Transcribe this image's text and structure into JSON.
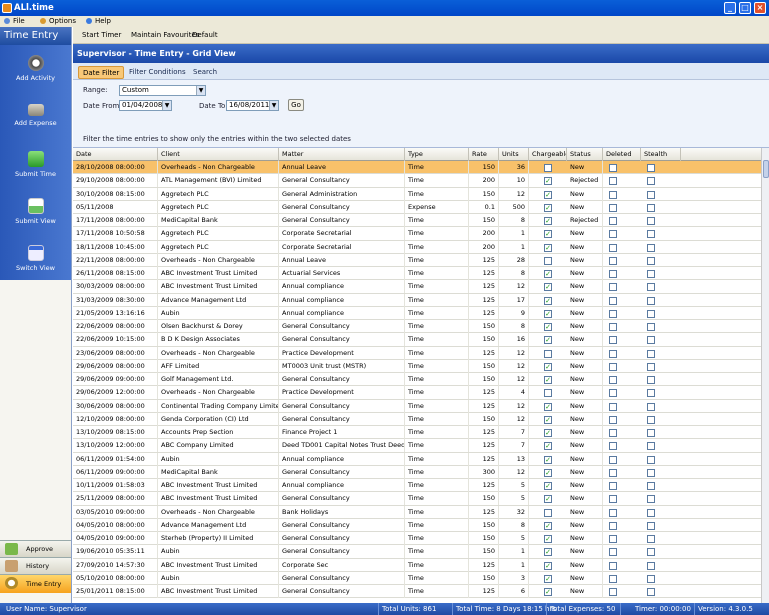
{
  "window": {
    "title": "ALl.time"
  },
  "menu": {
    "file": "File",
    "options": "Options",
    "help": "Help"
  },
  "sidebar": {
    "header": "Time Entry",
    "nav_items": [
      {
        "label": "Add Activity",
        "icon": "clock-icon"
      },
      {
        "label": "Add Expense",
        "icon": "scanner-icon"
      },
      {
        "label": "Submit Time",
        "icon": "upload-arrow-icon"
      },
      {
        "label": "Submit View",
        "icon": "submit-view-icon"
      },
      {
        "label": "Switch View",
        "icon": "window-icon"
      }
    ],
    "bottom_buttons": [
      {
        "label": "Approve",
        "icon": "approve-icon"
      },
      {
        "label": "History",
        "icon": "history-icon"
      },
      {
        "label": "Time Entry",
        "icon": "alarm-clock-icon"
      }
    ]
  },
  "toolbar": {
    "start_timer": "Start Timer",
    "maintain_favourites": "Maintain Favourites",
    "default": "Default"
  },
  "view_header": "Supervisor - Time Entry - Grid View",
  "filter_tabs": [
    "Date Filter",
    "Filter Conditions",
    "Search"
  ],
  "filter": {
    "range_label": "Range:",
    "range_value": "Custom",
    "date_from_label": "Date From:",
    "date_from_value": "01/04/2008",
    "date_to_label": "Date To:",
    "date_to_value": "16/08/2011",
    "go_label": "Go",
    "hint": "Filter the time entries to show only the entries within the two selected dates"
  },
  "grid": {
    "columns": [
      "Date",
      "Client",
      "Matter",
      "Type",
      "Rate",
      "Units",
      "Chargeable",
      "Status",
      "Deleted",
      "Stealth"
    ],
    "rows": [
      [
        "28/10/2008 08:00:00",
        "Overheads - Non Chargeable",
        "Annual Leave",
        "Time",
        "150",
        "36",
        false,
        "New"
      ],
      [
        "29/10/2008 08:00:00",
        "ATL Management (BVI) Limited",
        "General Consultancy",
        "Time",
        "200",
        "10",
        true,
        "Rejected"
      ],
      [
        "30/10/2008 08:15:00",
        "Aggretech PLC",
        "General Administration",
        "Time",
        "150",
        "12",
        true,
        "New"
      ],
      [
        "05/11/2008",
        "Aggretech PLC",
        "General Consultancy",
        "Expense",
        "0.1",
        "500",
        true,
        "New"
      ],
      [
        "17/11/2008 08:00:00",
        "MediCapital Bank",
        "General Consultancy",
        "Time",
        "150",
        "8",
        true,
        "Rejected"
      ],
      [
        "17/11/2008 10:50:58",
        "Aggretech PLC",
        "Corporate Secretarial",
        "Time",
        "200",
        "1",
        true,
        "New"
      ],
      [
        "18/11/2008 10:45:00",
        "Aggretech PLC",
        "Corporate Secretarial",
        "Time",
        "200",
        "1",
        true,
        "New"
      ],
      [
        "22/11/2008 08:00:00",
        "Overheads - Non Chargeable",
        "Annual Leave",
        "Time",
        "125",
        "28",
        false,
        "New"
      ],
      [
        "26/11/2008 08:15:00",
        "ABC Investment Trust Limited",
        "Actuarial Services",
        "Time",
        "125",
        "8",
        true,
        "New"
      ],
      [
        "30/03/2009 08:00:00",
        "ABC Investment Trust Limited",
        "Annual compliance",
        "Time",
        "125",
        "12",
        true,
        "New"
      ],
      [
        "31/03/2009 08:30:00",
        "Advance Management Ltd",
        "Annual compliance",
        "Time",
        "125",
        "17",
        true,
        "New"
      ],
      [
        "21/05/2009 13:16:16",
        "Aubin",
        "Annual compliance",
        "Time",
        "125",
        "9",
        true,
        "New"
      ],
      [
        "22/06/2009 08:00:00",
        "Olsen Backhurst & Dorey",
        "General Consultancy",
        "Time",
        "150",
        "8",
        true,
        "New"
      ],
      [
        "22/06/2009 10:15:00",
        "B D K Design Associates",
        "General Consultancy",
        "Time",
        "150",
        "16",
        true,
        "New"
      ],
      [
        "23/06/2009 08:00:00",
        "Overheads - Non Chargeable",
        "Practice Development",
        "Time",
        "125",
        "12",
        false,
        "New"
      ],
      [
        "29/06/2009 08:00:00",
        "AFF Limited",
        "MT0003 Unit trust (MSTR)",
        "Time",
        "150",
        "12",
        true,
        "New"
      ],
      [
        "29/06/2009 09:00:00",
        "Golf Management Ltd.",
        "General Consultancy",
        "Time",
        "150",
        "12",
        true,
        "New"
      ],
      [
        "29/06/2009 12:00:00",
        "Overheads - Non Chargeable",
        "Practice Development",
        "Time",
        "125",
        "4",
        false,
        "New"
      ],
      [
        "30/06/2009 08:00:00",
        "Continental Trading Company Limited",
        "General Consultancy",
        "Time",
        "125",
        "12",
        true,
        "New"
      ],
      [
        "12/10/2009 08:00:00",
        "Genda Corporation (CI) Ltd",
        "General Consultancy",
        "Time",
        "150",
        "12",
        true,
        "New"
      ],
      [
        "13/10/2009 08:15:00",
        "Accounts Prep Section",
        "Finance Project 1",
        "Time",
        "125",
        "7",
        true,
        "New"
      ],
      [
        "13/10/2009 12:00:00",
        "ABC Company Limited",
        "Deed TD001 Capital Notes Trust Deed",
        "Time",
        "125",
        "7",
        true,
        "New"
      ],
      [
        "06/11/2009 01:54:00",
        "Aubin",
        "Annual compliance",
        "Time",
        "125",
        "13",
        true,
        "New"
      ],
      [
        "06/11/2009 09:00:00",
        "MediCapital Bank",
        "General Consultancy",
        "Time",
        "300",
        "12",
        true,
        "New"
      ],
      [
        "10/11/2009 01:58:03",
        "ABC Investment Trust Limited",
        "Annual compliance",
        "Time",
        "125",
        "5",
        true,
        "New"
      ],
      [
        "25/11/2009 08:00:00",
        "ABC Investment Trust Limited",
        "General Consultancy",
        "Time",
        "150",
        "5",
        true,
        "New"
      ],
      [
        "03/05/2010 09:00:00",
        "Overheads - Non Chargeable",
        "Bank Holidays",
        "Time",
        "125",
        "32",
        false,
        "New"
      ],
      [
        "04/05/2010 08:00:00",
        "Advance Management Ltd",
        "General Consultancy",
        "Time",
        "150",
        "8",
        true,
        "New"
      ],
      [
        "04/05/2010 09:00:00",
        "Sterheb (Property) II Limited",
        "General Consultancy",
        "Time",
        "150",
        "5",
        true,
        "New"
      ],
      [
        "19/06/2010 05:35:11",
        "Aubin",
        "General Consultancy",
        "Time",
        "150",
        "1",
        true,
        "New"
      ],
      [
        "27/09/2010 14:57:30",
        "ABC Investment Trust Limited",
        "Corporate Sec",
        "Time",
        "125",
        "1",
        true,
        "New"
      ],
      [
        "05/10/2010 08:00:00",
        "Aubin",
        "General Consultancy",
        "Time",
        "150",
        "3",
        true,
        "New"
      ],
      [
        "25/01/2011 08:15:00",
        "ABC Investment Trust Limited",
        "General Consultancy",
        "Time",
        "125",
        "6",
        true,
        "New"
      ]
    ]
  },
  "status_bar": {
    "user": "User Name: Supervisor",
    "total_units": "Total Units: 861",
    "total_time": "Total Time: 8 Days 18:15 hrs",
    "total_expenses": "Total Expenses: 50",
    "timer": "Timer: 00:00:00",
    "version": "Version: 4.3.0.5"
  },
  "colors": {
    "accent": "#1a48a8",
    "selected_row": "#f8c16a",
    "active_tab": "#f8c878"
  }
}
